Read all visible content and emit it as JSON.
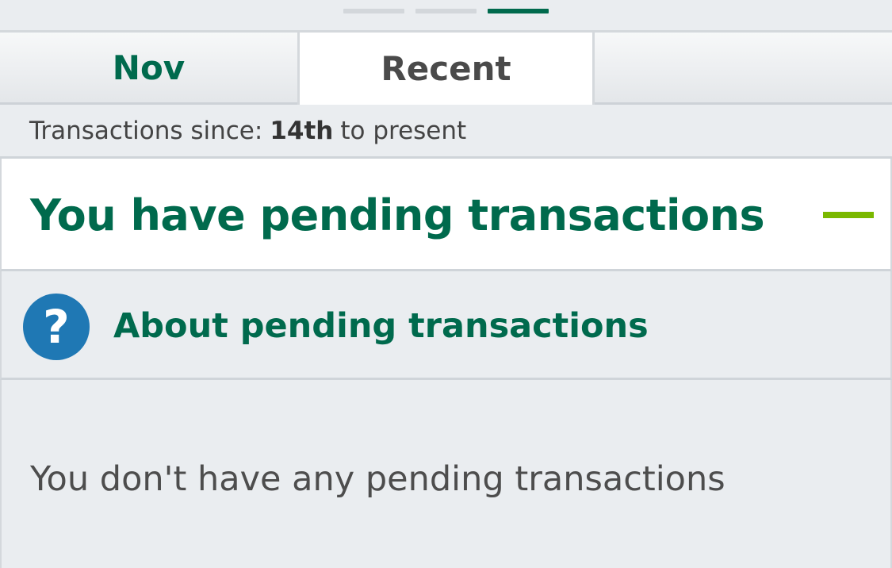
{
  "page_indicator": {
    "count": 3,
    "active_index": 2
  },
  "tabs": [
    {
      "label": "Nov",
      "active": false
    },
    {
      "label": "Recent",
      "active": true
    }
  ],
  "since": {
    "prefix": "Transactions since:",
    "date": "14th",
    "suffix": "to present"
  },
  "pending": {
    "title": "You have pending transactions",
    "collapse_icon": "minus-icon"
  },
  "about": {
    "icon": "question-icon",
    "icon_glyph": "?",
    "label": "About pending transactions"
  },
  "empty_message": "You don't have any pending transactions",
  "colors": {
    "brand_green": "#006a4d",
    "accent_lime": "#7ab800",
    "help_blue": "#1f78b4",
    "background": "#eaedf0"
  }
}
